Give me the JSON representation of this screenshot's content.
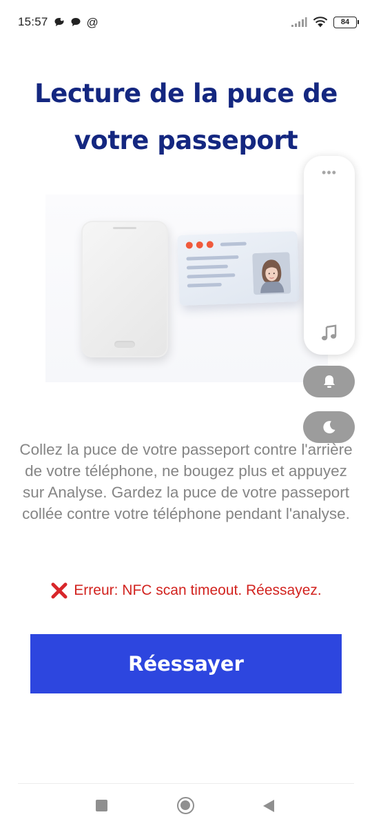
{
  "status_bar": {
    "time": "15:57",
    "at_symbol": "@",
    "battery": "84",
    "icons": [
      "chat-bubble-icon",
      "chat-bubble-icon",
      "signal-icon",
      "wifi-icon",
      "battery-icon"
    ]
  },
  "page": {
    "title": "Lecture de la puce de votre passeport",
    "description": "Collez la puce de votre passeport contre l'arrière de votre téléphone, ne bougez plus et appuyez sur Analyse. Gardez la puce de votre passeport collée contre votre téléphone pendant l'analyse.",
    "error_message": "Erreur: NFC scan timeout. Réessayez.",
    "retry_label": "Réessayer"
  },
  "floating_panel": {
    "menu_dots": "•••",
    "icons": [
      "music-note-icon",
      "bell-icon",
      "moon-icon"
    ]
  },
  "nav_bar": {
    "icons": [
      "recents-icon",
      "home-icon",
      "back-icon"
    ]
  },
  "colors": {
    "title": "#142780",
    "button": "#2d46df",
    "error": "#d2231f",
    "description": "#858585"
  }
}
